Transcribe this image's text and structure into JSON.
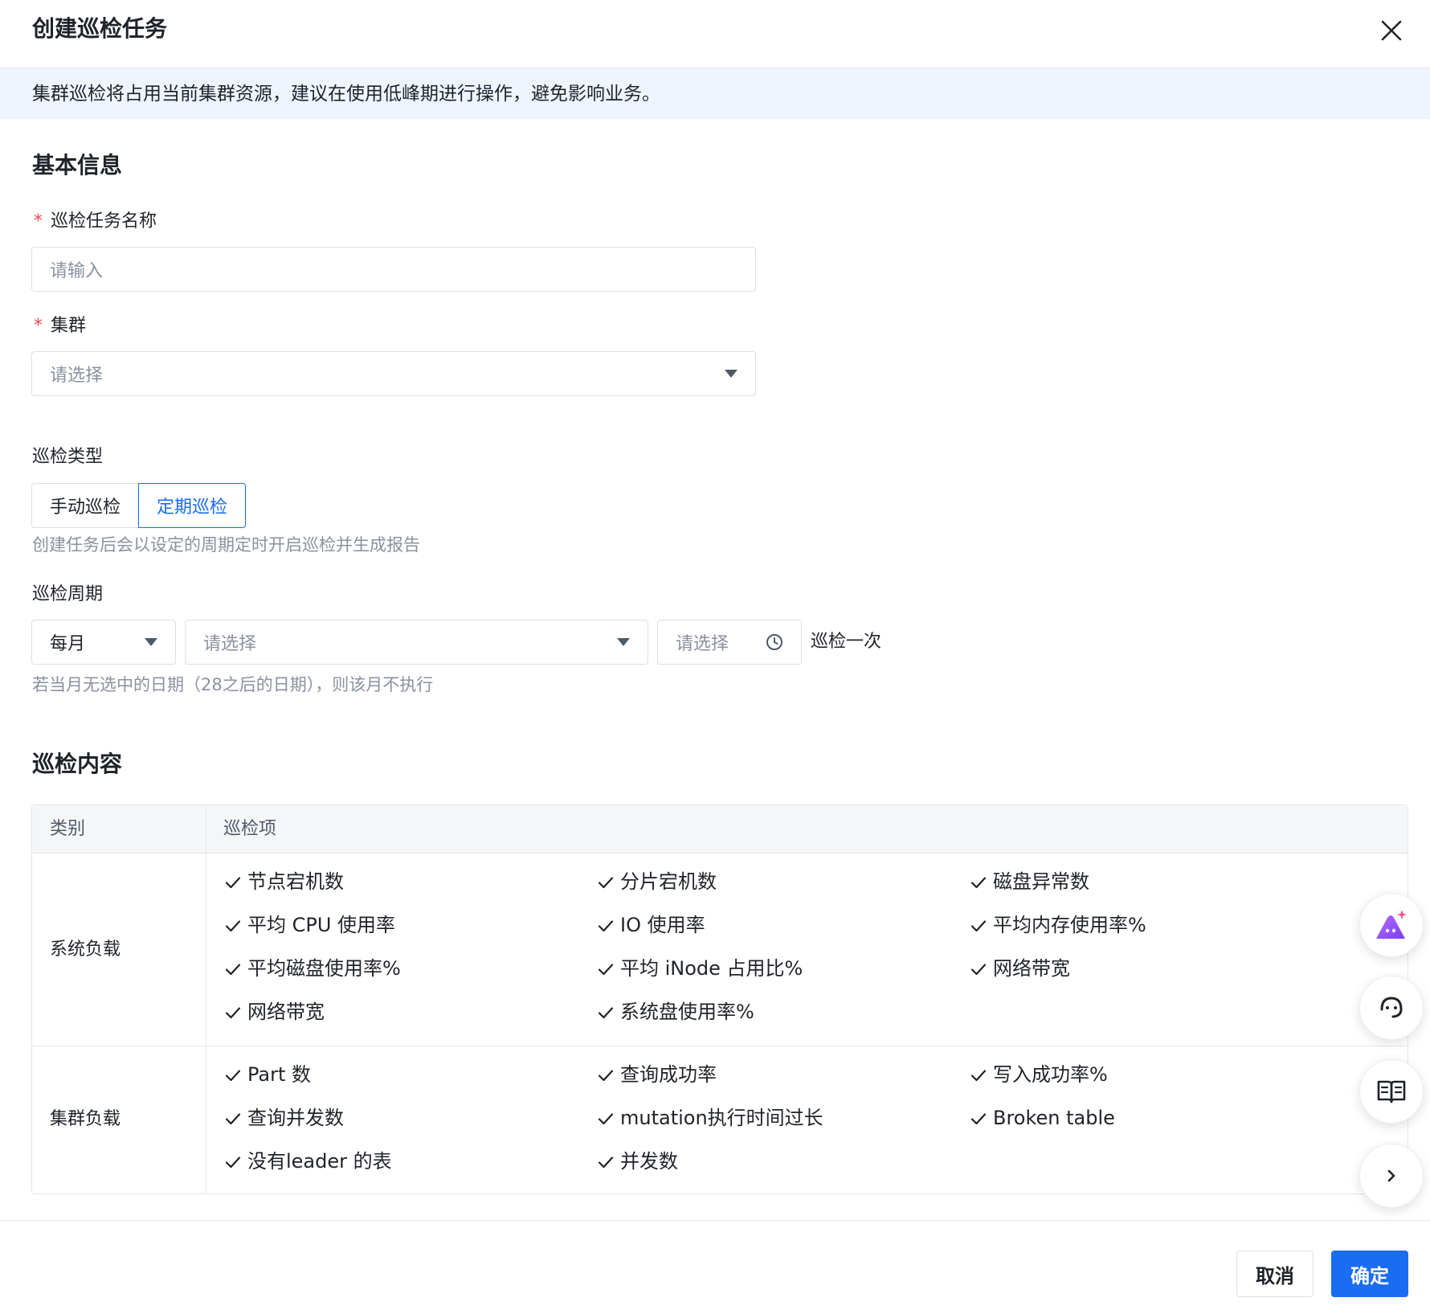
{
  "dialog": {
    "title": "创建巡检任务"
  },
  "notice": {
    "text": "集群巡检将占用当前集群资源，建议在使用低峰期进行操作，避免影响业务。"
  },
  "basic_info": {
    "section_title": "基本信息",
    "task_name": {
      "label": "巡检任务名称",
      "required_mark": "*",
      "placeholder": "请输入"
    },
    "cluster": {
      "label": "集群",
      "required_mark": "*",
      "placeholder": "请选择"
    }
  },
  "inspection_type": {
    "label": "巡检类型",
    "options": [
      "手动巡检",
      "定期巡检"
    ],
    "selected": "定期巡检",
    "hint": "创建任务后会以设定的周期定时开启巡检并生成报告"
  },
  "inspection_cycle": {
    "label": "巡检周期",
    "frequency": "每月",
    "date_placeholder": "请选择",
    "time_placeholder": "请选择",
    "suffix": "巡检一次",
    "hint": "若当月无选中的日期（28之后的日期），则该月不执行"
  },
  "content": {
    "section_title": "巡检内容",
    "headers": {
      "category": "类别",
      "items": "巡检项"
    },
    "groups": [
      {
        "category": "系统负载",
        "items": [
          "节点宕机数",
          "分片宕机数",
          "磁盘异常数",
          "平均 CPU 使用率",
          "IO 使用率",
          "平均内存使用率%",
          "平均磁盘使用率%",
          "平均 iNode 占用比%",
          "网络带宽",
          "网络带宽",
          "系统盘使用率%"
        ]
      },
      {
        "category": "集群负载",
        "items": [
          "Part 数",
          "查询成功率",
          "写入成功率%",
          "查询并发数",
          "mutation执行时间过长",
          "Broken table",
          "没有leader 的表",
          "并发数"
        ]
      }
    ]
  },
  "floating": [
    "ai-assistant-icon",
    "customer-service-icon",
    "docs-book-icon",
    "chevron-right-icon"
  ],
  "footer": {
    "cancel_label": "取消",
    "ok_label": "确定"
  },
  "colors": {
    "primary": "#1a6cf0",
    "notice_bg": "#eff5fe",
    "required": "#e5484d",
    "hint": "#8a919f"
  }
}
